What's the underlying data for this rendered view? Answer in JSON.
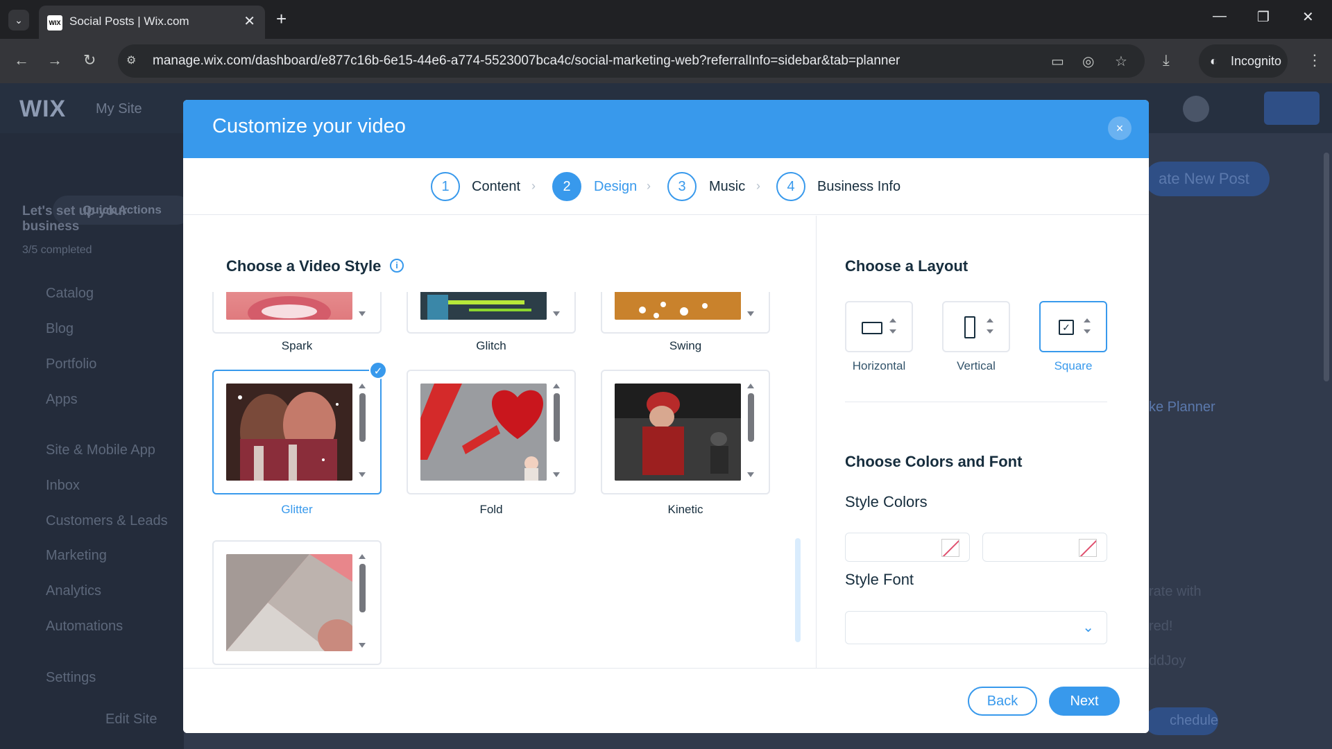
{
  "browser": {
    "tab_title": "Social Posts | Wix.com",
    "favicon_text": "WIX",
    "url": "manage.wix.com/dashboard/e877c16b-6e15-44e6-a774-5523007bca4c/social-marketing-web?referralInfo=sidebar&tab=planner",
    "incognito_label": "Incognito"
  },
  "dashboard": {
    "logo": "WIX",
    "site_name": "My Site",
    "quick_actions": "Quick Actions",
    "setup_title": "Let's set up your business",
    "setup_progress": "3/5 completed",
    "sidebar_items": [
      "Catalog",
      "Blog",
      "Portfolio",
      "Apps",
      "Site & Mobile App",
      "Inbox",
      "Customers & Leads",
      "Marketing",
      "Analytics",
      "Automations",
      "Settings"
    ],
    "edit_site": "Edit Site",
    "create_post": "ate New Post",
    "planner_text": "ke Planner",
    "side_text_1": "rate with",
    "side_text_2": "red!",
    "side_text_3": "ddJoy",
    "schedule_btn": "chedule"
  },
  "modal": {
    "title": "Customize your video",
    "close_label": "×",
    "steps": [
      {
        "num": "1",
        "label": "Content"
      },
      {
        "num": "2",
        "label": "Design"
      },
      {
        "num": "3",
        "label": "Music"
      },
      {
        "num": "4",
        "label": "Business Info"
      }
    ],
    "active_step": 2,
    "video_style_title": "Choose a Video Style",
    "styles": [
      {
        "label": "Spark"
      },
      {
        "label": "Glitch"
      },
      {
        "label": "Swing"
      },
      {
        "label": "Glitter",
        "selected": true
      },
      {
        "label": "Fold"
      },
      {
        "label": "Kinetic"
      },
      {
        "label": ""
      }
    ],
    "layout_title": "Choose a Layout",
    "layouts": [
      {
        "label": "Horizontal"
      },
      {
        "label": "Vertical"
      },
      {
        "label": "Square",
        "selected": true
      }
    ],
    "colors_font_title": "Choose Colors and Font",
    "style_colors_label": "Style Colors",
    "style_font_label": "Style Font",
    "style_font_value": "",
    "back_label": "Back",
    "next_label": "Next"
  },
  "colors": {
    "accent": "#3899ec",
    "header": "#3899ec",
    "text": "#162d3d"
  }
}
